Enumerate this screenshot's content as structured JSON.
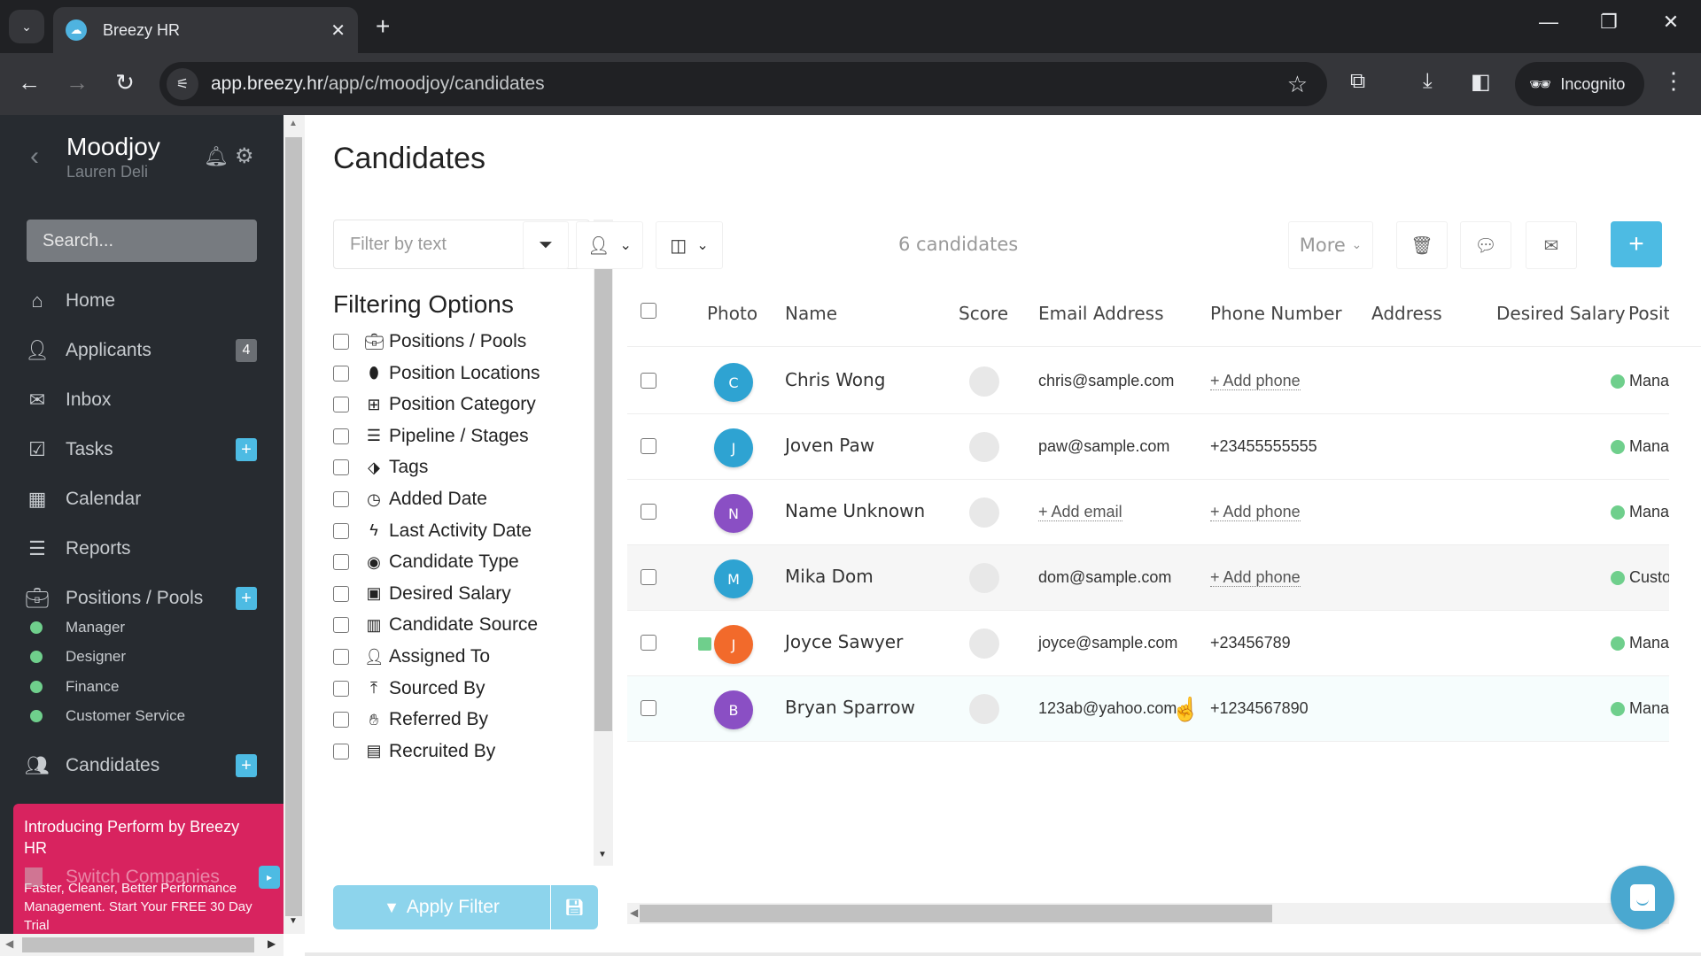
{
  "browser": {
    "tab_title": "Breezy HR",
    "url_host": "app.breezy.hr",
    "url_path": "/app/c/moodjoy/candidates",
    "incognito_label": "Incognito"
  },
  "sidebar": {
    "company": "Moodjoy",
    "user": "Lauren Deli",
    "search_placeholder": "Search...",
    "items": [
      {
        "label": "Home",
        "icon": "home-icon"
      },
      {
        "label": "Applicants",
        "icon": "user-icon",
        "badge": "4"
      },
      {
        "label": "Inbox",
        "icon": "envelope-icon"
      },
      {
        "label": "Tasks",
        "icon": "checkbox-icon",
        "plus": true
      },
      {
        "label": "Calendar",
        "icon": "calendar-icon"
      },
      {
        "label": "Reports",
        "icon": "bar-chart-icon"
      },
      {
        "label": "Positions / Pools",
        "icon": "briefcase-icon",
        "plus": true
      },
      {
        "label": "Candidates",
        "icon": "users-icon",
        "plus": true
      }
    ],
    "positions": [
      "Manager",
      "Designer",
      "Finance",
      "Customer Service"
    ],
    "switch_companies": "Switch Companies",
    "promo": {
      "title": "Introducing Perform by Breezy HR",
      "subtitle": "Faster, Cleaner, Better Performance Management. Start Your FREE 30 Day Trial"
    }
  },
  "main": {
    "title": "Candidates",
    "filter": {
      "placeholder": "Filter by text",
      "heading": "Filtering Options",
      "options": [
        {
          "label": "Positions / Pools",
          "icon": "briefcase-icon"
        },
        {
          "label": "Position Locations",
          "icon": "map-marker-icon"
        },
        {
          "label": "Position Category",
          "icon": "grid-icon"
        },
        {
          "label": "Pipeline / Stages",
          "icon": "ordered-list-icon"
        },
        {
          "label": "Tags",
          "icon": "tag-icon"
        },
        {
          "label": "Added Date",
          "icon": "clock-icon"
        },
        {
          "label": "Last Activity Date",
          "icon": "bolt-icon"
        },
        {
          "label": "Candidate Type",
          "icon": "user-circle-icon"
        },
        {
          "label": "Desired Salary",
          "icon": "money-icon"
        },
        {
          "label": "Candidate Source",
          "icon": "map-icon"
        },
        {
          "label": "Assigned To",
          "icon": "user-plus-icon"
        },
        {
          "label": "Sourced By",
          "icon": "upload-icon"
        },
        {
          "label": "Referred By",
          "icon": "handshake-icon"
        },
        {
          "label": "Recruited By",
          "icon": "id-card-icon"
        }
      ],
      "apply_label": "Apply Filter"
    },
    "toolbar": {
      "count_label": "6 candidates",
      "more_label": "More"
    },
    "table": {
      "columns": [
        "Photo",
        "Name",
        "Score",
        "Email Address",
        "Phone Number",
        "Address",
        "Desired Salary",
        "Position"
      ],
      "rows": [
        {
          "initial": "C",
          "avatar_color": "#2ea3d2",
          "name": "Chris Wong",
          "email": "chris@sample.com",
          "email_is_link": false,
          "phone": "+ Add phone",
          "phone_is_link": true,
          "position": "Manager",
          "state": ""
        },
        {
          "initial": "J",
          "avatar_color": "#2ea3d2",
          "name": "Joven Paw",
          "email": "paw@sample.com",
          "email_is_link": false,
          "phone": "+23455555555",
          "phone_is_link": false,
          "position": "Manager",
          "state": ""
        },
        {
          "initial": "N",
          "avatar_color": "#8a4fc4",
          "name": "Name Unknown",
          "email": "+ Add email",
          "email_is_link": true,
          "phone": "+ Add phone",
          "phone_is_link": true,
          "position": "Manager",
          "state": ""
        },
        {
          "initial": "M",
          "avatar_color": "#2ea3d2",
          "name": "Mika Dom",
          "email": "dom@sample.com",
          "email_is_link": false,
          "phone": "+ Add phone",
          "phone_is_link": true,
          "position": "Customer Service",
          "state": "hover"
        },
        {
          "initial": "J",
          "avatar_color": "#f26a2b",
          "name": "Joyce Sawyer",
          "email": "joyce@sample.com",
          "email_is_link": false,
          "phone": "+23456789",
          "phone_is_link": false,
          "position": "Manager",
          "state": "",
          "new_marker": true
        },
        {
          "initial": "B",
          "avatar_color": "#8a4fc4",
          "name": "Bryan Sparrow",
          "email": "123ab@yahoo.com",
          "email_is_link": false,
          "phone": "+1234567890",
          "phone_is_link": false,
          "position": "Manager",
          "state": "selected"
        }
      ]
    }
  },
  "colors": {
    "accent": "#4dbbe3",
    "sidebar_bg": "#272b30",
    "promo_bg": "#d8235f",
    "position_dot": "#6fcf8c"
  }
}
